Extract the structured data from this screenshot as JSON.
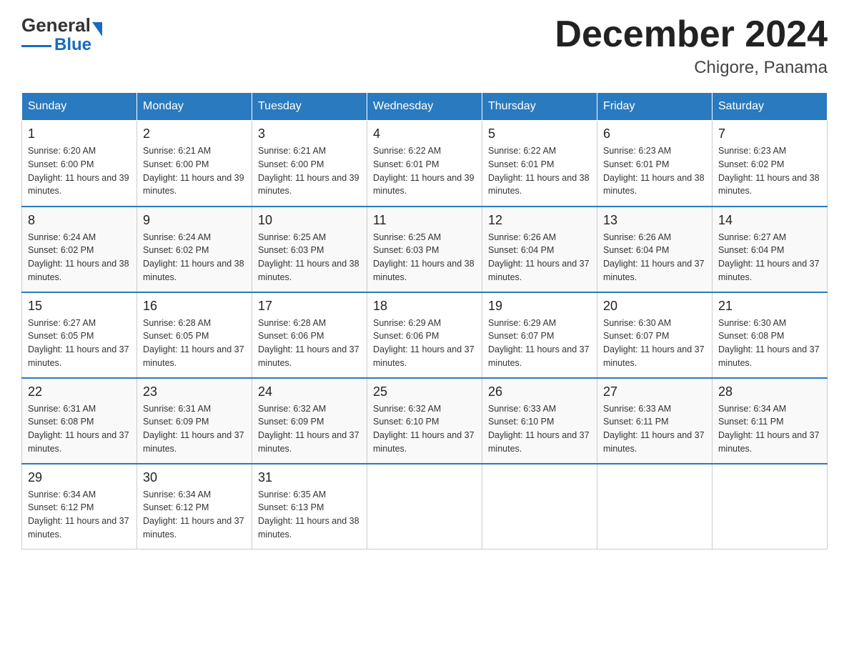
{
  "logo": {
    "text_general": "General",
    "text_blue": "Blue"
  },
  "title": "December 2024",
  "subtitle": "Chigore, Panama",
  "days_of_week": [
    "Sunday",
    "Monday",
    "Tuesday",
    "Wednesday",
    "Thursday",
    "Friday",
    "Saturday"
  ],
  "weeks": [
    [
      {
        "day": "1",
        "sunrise": "6:20 AM",
        "sunset": "6:00 PM",
        "daylight": "11 hours and 39 minutes."
      },
      {
        "day": "2",
        "sunrise": "6:21 AM",
        "sunset": "6:00 PM",
        "daylight": "11 hours and 39 minutes."
      },
      {
        "day": "3",
        "sunrise": "6:21 AM",
        "sunset": "6:00 PM",
        "daylight": "11 hours and 39 minutes."
      },
      {
        "day": "4",
        "sunrise": "6:22 AM",
        "sunset": "6:01 PM",
        "daylight": "11 hours and 39 minutes."
      },
      {
        "day": "5",
        "sunrise": "6:22 AM",
        "sunset": "6:01 PM",
        "daylight": "11 hours and 38 minutes."
      },
      {
        "day": "6",
        "sunrise": "6:23 AM",
        "sunset": "6:01 PM",
        "daylight": "11 hours and 38 minutes."
      },
      {
        "day": "7",
        "sunrise": "6:23 AM",
        "sunset": "6:02 PM",
        "daylight": "11 hours and 38 minutes."
      }
    ],
    [
      {
        "day": "8",
        "sunrise": "6:24 AM",
        "sunset": "6:02 PM",
        "daylight": "11 hours and 38 minutes."
      },
      {
        "day": "9",
        "sunrise": "6:24 AM",
        "sunset": "6:02 PM",
        "daylight": "11 hours and 38 minutes."
      },
      {
        "day": "10",
        "sunrise": "6:25 AM",
        "sunset": "6:03 PM",
        "daylight": "11 hours and 38 minutes."
      },
      {
        "day": "11",
        "sunrise": "6:25 AM",
        "sunset": "6:03 PM",
        "daylight": "11 hours and 38 minutes."
      },
      {
        "day": "12",
        "sunrise": "6:26 AM",
        "sunset": "6:04 PM",
        "daylight": "11 hours and 37 minutes."
      },
      {
        "day": "13",
        "sunrise": "6:26 AM",
        "sunset": "6:04 PM",
        "daylight": "11 hours and 37 minutes."
      },
      {
        "day": "14",
        "sunrise": "6:27 AM",
        "sunset": "6:04 PM",
        "daylight": "11 hours and 37 minutes."
      }
    ],
    [
      {
        "day": "15",
        "sunrise": "6:27 AM",
        "sunset": "6:05 PM",
        "daylight": "11 hours and 37 minutes."
      },
      {
        "day": "16",
        "sunrise": "6:28 AM",
        "sunset": "6:05 PM",
        "daylight": "11 hours and 37 minutes."
      },
      {
        "day": "17",
        "sunrise": "6:28 AM",
        "sunset": "6:06 PM",
        "daylight": "11 hours and 37 minutes."
      },
      {
        "day": "18",
        "sunrise": "6:29 AM",
        "sunset": "6:06 PM",
        "daylight": "11 hours and 37 minutes."
      },
      {
        "day": "19",
        "sunrise": "6:29 AM",
        "sunset": "6:07 PM",
        "daylight": "11 hours and 37 minutes."
      },
      {
        "day": "20",
        "sunrise": "6:30 AM",
        "sunset": "6:07 PM",
        "daylight": "11 hours and 37 minutes."
      },
      {
        "day": "21",
        "sunrise": "6:30 AM",
        "sunset": "6:08 PM",
        "daylight": "11 hours and 37 minutes."
      }
    ],
    [
      {
        "day": "22",
        "sunrise": "6:31 AM",
        "sunset": "6:08 PM",
        "daylight": "11 hours and 37 minutes."
      },
      {
        "day": "23",
        "sunrise": "6:31 AM",
        "sunset": "6:09 PM",
        "daylight": "11 hours and 37 minutes."
      },
      {
        "day": "24",
        "sunrise": "6:32 AM",
        "sunset": "6:09 PM",
        "daylight": "11 hours and 37 minutes."
      },
      {
        "day": "25",
        "sunrise": "6:32 AM",
        "sunset": "6:10 PM",
        "daylight": "11 hours and 37 minutes."
      },
      {
        "day": "26",
        "sunrise": "6:33 AM",
        "sunset": "6:10 PM",
        "daylight": "11 hours and 37 minutes."
      },
      {
        "day": "27",
        "sunrise": "6:33 AM",
        "sunset": "6:11 PM",
        "daylight": "11 hours and 37 minutes."
      },
      {
        "day": "28",
        "sunrise": "6:34 AM",
        "sunset": "6:11 PM",
        "daylight": "11 hours and 37 minutes."
      }
    ],
    [
      {
        "day": "29",
        "sunrise": "6:34 AM",
        "sunset": "6:12 PM",
        "daylight": "11 hours and 37 minutes."
      },
      {
        "day": "30",
        "sunrise": "6:34 AM",
        "sunset": "6:12 PM",
        "daylight": "11 hours and 37 minutes."
      },
      {
        "day": "31",
        "sunrise": "6:35 AM",
        "sunset": "6:13 PM",
        "daylight": "11 hours and 38 minutes."
      },
      null,
      null,
      null,
      null
    ]
  ]
}
